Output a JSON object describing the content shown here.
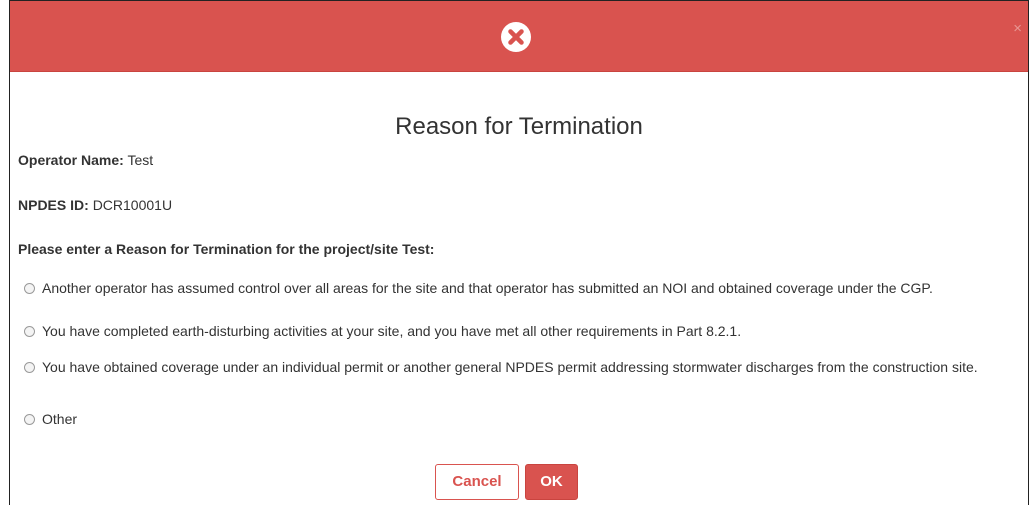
{
  "dialog": {
    "header_icon": "error-x-icon",
    "close_glyph": "×",
    "title": "Reason for Termination",
    "operator": {
      "label": "Operator Name:",
      "value": "Test"
    },
    "npdes": {
      "label": "NPDES ID:",
      "value": "DCR10001U"
    },
    "prompt": "Please enter a Reason for Termination for the project/site Test:",
    "options": [
      {
        "text": "Another operator has assumed control over all areas for the site and that operator has submitted an NOI and obtained coverage under the CGP.",
        "selected": false
      },
      {
        "text": "You have completed earth-disturbing activities at your site, and you have met all other requirements in Part 8.2.1.",
        "selected": false
      },
      {
        "text": "You have obtained coverage under an individual permit or another general NPDES permit addressing stormwater discharges from the construction site.",
        "selected": false
      },
      {
        "text": "Other",
        "selected": false
      }
    ],
    "buttons": {
      "cancel": "Cancel",
      "ok": "OK"
    },
    "colors": {
      "accent": "#d9534f"
    }
  }
}
